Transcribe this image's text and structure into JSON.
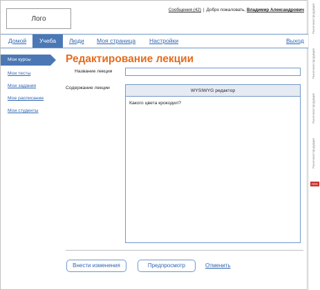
{
  "header": {
    "logo": "Лого",
    "messages_link": "Сообщения (42)",
    "separator": "|",
    "welcome": "Добро пожаловать,",
    "user_name": "Владимир Александрович"
  },
  "nav": {
    "items": [
      {
        "label": "Домой",
        "active": false
      },
      {
        "label": "Учеба",
        "active": true
      },
      {
        "label": "Люди",
        "active": false
      },
      {
        "label": "Моя страница",
        "active": false
      },
      {
        "label": "Настройки",
        "active": false
      }
    ],
    "logout": "Выход"
  },
  "sidebar": {
    "items": [
      {
        "label": "Мои курсы",
        "active": true
      },
      {
        "label": "Мои тесты",
        "active": false
      },
      {
        "label": "Мои задания",
        "active": false
      },
      {
        "label": "Мое расписание",
        "active": false
      },
      {
        "label": "Мои студенты",
        "active": false
      }
    ]
  },
  "main": {
    "title": "Редактирование лекции",
    "name_label": "Название лекции",
    "name_value": "",
    "content_label": "Содержание лекции",
    "editor_title": "WYSIWYG редактор",
    "editor_content": "Какого цвета крокодил?"
  },
  "actions": {
    "save": "Внести изменения",
    "preview": "Предпросмотр",
    "cancel": "Отменить"
  },
  "right_rail": {
    "labels": [
      "Рыночная продукция",
      "Рыночная продукция",
      "Рыночная продукция",
      "Рыночная продукция"
    ],
    "badge": "RRR"
  },
  "colors": {
    "accent": "#4b78b5",
    "link": "#2e64b1",
    "title": "#e36c1f",
    "border": "#7096c7"
  }
}
